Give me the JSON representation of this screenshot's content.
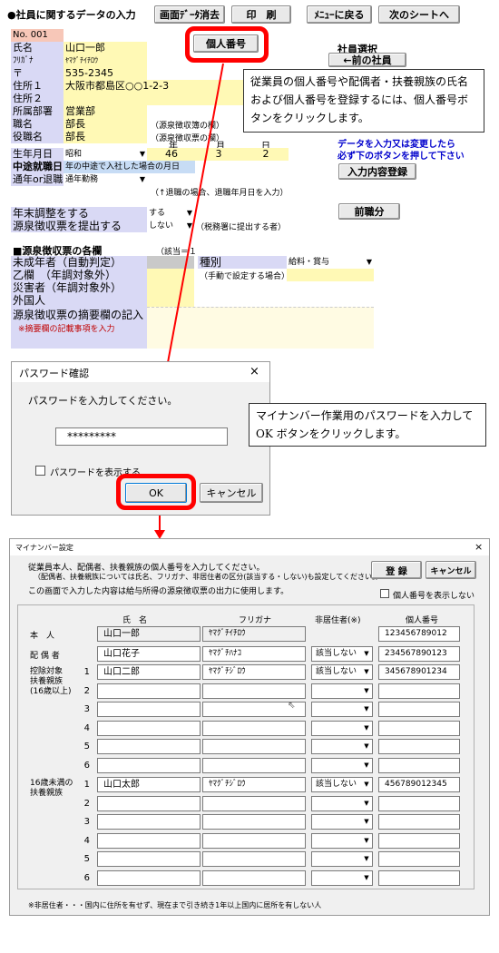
{
  "sheet": {
    "title": "●社員に関するデータの入力",
    "toolbar": {
      "clear": "画面ﾃﾞｰﾀ消去",
      "print": "印　刷",
      "menu": "ﾒﾆｭｰに戻る",
      "next": "次のシートへ"
    },
    "record_no": "No. 001",
    "mynumber_button": "個人番号",
    "fields": {
      "name_label": "氏名",
      "name_value": "山口一郎",
      "kana_label": "ﾌﾘｶﾞﾅ",
      "kana_value": "ﾔﾏｸﾞﾁｲﾁﾛｳ",
      "zip_label": "〒",
      "zip_value": "535-2345",
      "addr1_label": "住所１",
      "addr1_value": "大阪市都島区○○1-2-3",
      "addr2_label": "住所２",
      "dept_label": "所属部署",
      "dept_value": "営業部",
      "title_label": "職名",
      "title_value": "部長",
      "title_note": "（源泉徴収簿の欄）",
      "role_label": "役職名",
      "role_value": "部長",
      "role_note": "（源泉徴収票の欄）"
    },
    "employee_select": {
      "label": "社員選択",
      "prev": "←前の社員"
    },
    "birth": {
      "label": "生年月日",
      "era": "昭和",
      "col_year": "年",
      "col_month": "月",
      "col_day": "日",
      "year": "46",
      "month": "3",
      "day": "2"
    },
    "mid_hire": {
      "label": "中途就職日",
      "value": "年の中途で入社した場合の月日"
    },
    "status": {
      "label": "通年or退職",
      "value": "通年勤務",
      "note": "（↑退職の場合、退職年月日を入力）"
    },
    "instruction": "データを入力又は変更したら\n必ず下のボタンを押して下さい",
    "register_input_button": "入力内容登録",
    "year_end": {
      "label": "年末調整をする",
      "value": "する"
    },
    "withholding": {
      "label": "源泉徴収票を提出する",
      "value": "しない",
      "note": "（税務署に提出する者）"
    },
    "prev_job_button": "前職分",
    "section2_title": "■源泉徴収票の各欄",
    "section2_note": "（該当＝１",
    "minor": "未成年者（自動判定）",
    "kind_label": "種別",
    "kind_value": "給料・賞与",
    "col_b": "乙欄　（年調対象外）",
    "manual_note": "（手動で設定する場合）→",
    "disaster": "災害者（年調対象外）",
    "foreign": "外国人",
    "remarks": "源泉徴収票の摘要欄の記入",
    "remarks_sub": "※摘要欄の記載事項を入力"
  },
  "callout1": "従業員の個人番号や配偶者・扶養親族の氏名および個人番号を登録するには、個人番号ボタンをクリックします。",
  "password_dialog": {
    "title": "パスワード確認",
    "close": "×",
    "prompt": "パスワードを入力してください。",
    "value": "*********",
    "show_label": "パスワードを表示する",
    "ok": "OK",
    "cancel": "キャンセル"
  },
  "callout2": "マイナンバー作業用のパスワードを入力して OK ボタンをクリックします。",
  "mynumber_dialog": {
    "title": "マイナンバー設定",
    "close": "×",
    "desc1": "従業員本人、配偶者、扶養親族の個人番号を入力してください。",
    "desc2": "（配偶者、扶養親族については氏名、フリガナ、非居住者の区分(該当する・しない)も設定してください。）",
    "desc3": "この画面で入力した内容は給与所得の源泉徴収票の出力に使用します。",
    "register": "登 録",
    "cancel": "キャンセル",
    "hide_label": "個人番号を表示しない",
    "headers": {
      "name": "氏　名",
      "kana": "フリガナ",
      "nonres": "非居住者(※)",
      "number": "個人番号"
    },
    "self_label": "本　人",
    "spouse_label": "配 偶 者",
    "deps_label": "控除対象\n扶養親族\n(16歳以上)",
    "under16_label": "16歳未満の\n扶養親族",
    "self": {
      "name": "山口一郎",
      "kana": "ﾔﾏｸﾞﾁｲﾁﾛｳ",
      "number": "123456789012"
    },
    "spouse": {
      "name": "山口花子",
      "kana": "ﾔﾏｸﾞﾁﾊﾅｺ",
      "nonres": "該当しない",
      "number": "234567890123"
    },
    "deps": [
      {
        "no": "1",
        "name": "山口二郎",
        "kana": "ﾔﾏｸﾞﾁｼﾞﾛｳ",
        "nonres": "該当しない",
        "number": "345678901234"
      },
      {
        "no": "2",
        "name": "",
        "kana": "",
        "nonres": "",
        "number": ""
      },
      {
        "no": "3",
        "name": "",
        "kana": "",
        "nonres": "",
        "number": ""
      },
      {
        "no": "4",
        "name": "",
        "kana": "",
        "nonres": "",
        "number": ""
      },
      {
        "no": "5",
        "name": "",
        "kana": "",
        "nonres": "",
        "number": ""
      },
      {
        "no": "6",
        "name": "",
        "kana": "",
        "nonres": "",
        "number": ""
      }
    ],
    "under16": [
      {
        "no": "1",
        "name": "山口太郎",
        "kana": "ﾔﾏｸﾞﾁｼﾞﾛｳ",
        "nonres": "該当しない",
        "number": "456789012345"
      },
      {
        "no": "2",
        "name": "",
        "kana": "",
        "nonres": "",
        "number": ""
      },
      {
        "no": "3",
        "name": "",
        "kana": "",
        "nonres": "",
        "number": ""
      },
      {
        "no": "4",
        "name": "",
        "kana": "",
        "nonres": "",
        "number": ""
      },
      {
        "no": "5",
        "name": "",
        "kana": "",
        "nonres": "",
        "number": ""
      },
      {
        "no": "6",
        "name": "",
        "kana": "",
        "nonres": "",
        "number": ""
      }
    ],
    "footnote": "※非居住者・・・国内に住所を有せず、現在まで引き続き1年以上国内に居所を有しない人"
  },
  "colors": {
    "highlight": "#ff0000",
    "link_blue": "#0000cc",
    "note_red": "#c00000"
  }
}
